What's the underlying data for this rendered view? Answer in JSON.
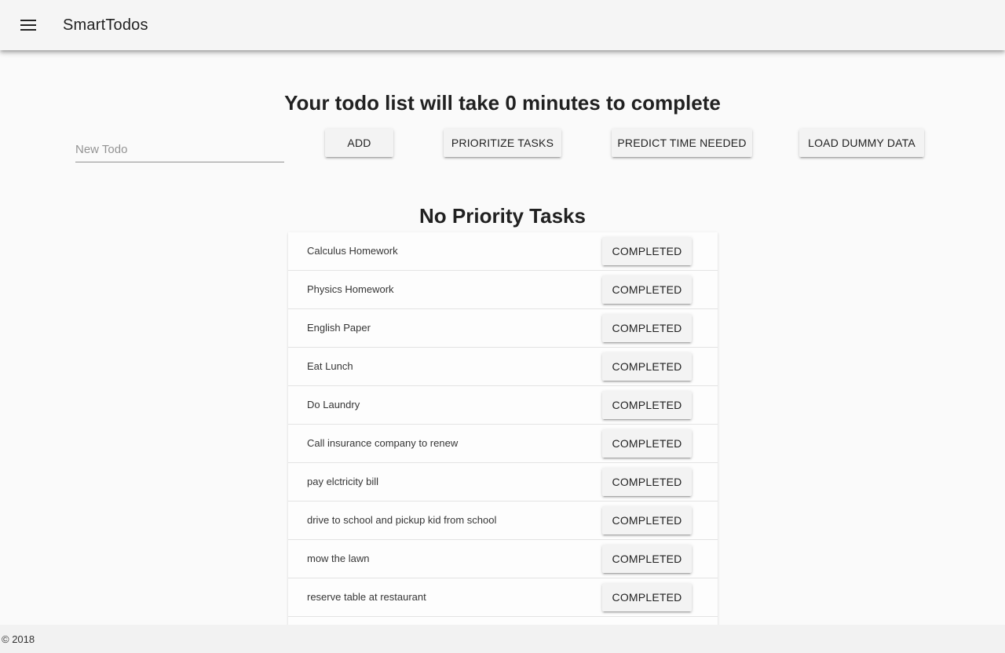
{
  "toolbar": {
    "menu_icon": "menu-icon",
    "title": "SmartTodos"
  },
  "main": {
    "headline": "Your todo list will take 0 minutes to complete",
    "new_todo_placeholder": "New Todo",
    "new_todo_value": "",
    "buttons": {
      "add": "ADD",
      "prioritize": "PRIORITIZE TASKS",
      "predict": "PREDICT TIME NEEDED",
      "load_dummy": "LOAD DUMMY DATA"
    },
    "section_title": "No Priority Tasks",
    "tasks": [
      {
        "label": "Calculus Homework",
        "action": "COMPLETED"
      },
      {
        "label": "Physics Homework",
        "action": "COMPLETED"
      },
      {
        "label": "English Paper",
        "action": "COMPLETED"
      },
      {
        "label": "Eat Lunch",
        "action": "COMPLETED"
      },
      {
        "label": "Do Laundry",
        "action": "COMPLETED"
      },
      {
        "label": "Call insurance company to renew",
        "action": "COMPLETED"
      },
      {
        "label": "pay elctricity bill",
        "action": "COMPLETED"
      },
      {
        "label": "drive to school and pickup kid from school",
        "action": "COMPLETED"
      },
      {
        "label": "mow the lawn",
        "action": "COMPLETED"
      },
      {
        "label": "reserve table at restaurant",
        "action": "COMPLETED"
      }
    ]
  },
  "footer": {
    "copyright": "© 2018"
  }
}
